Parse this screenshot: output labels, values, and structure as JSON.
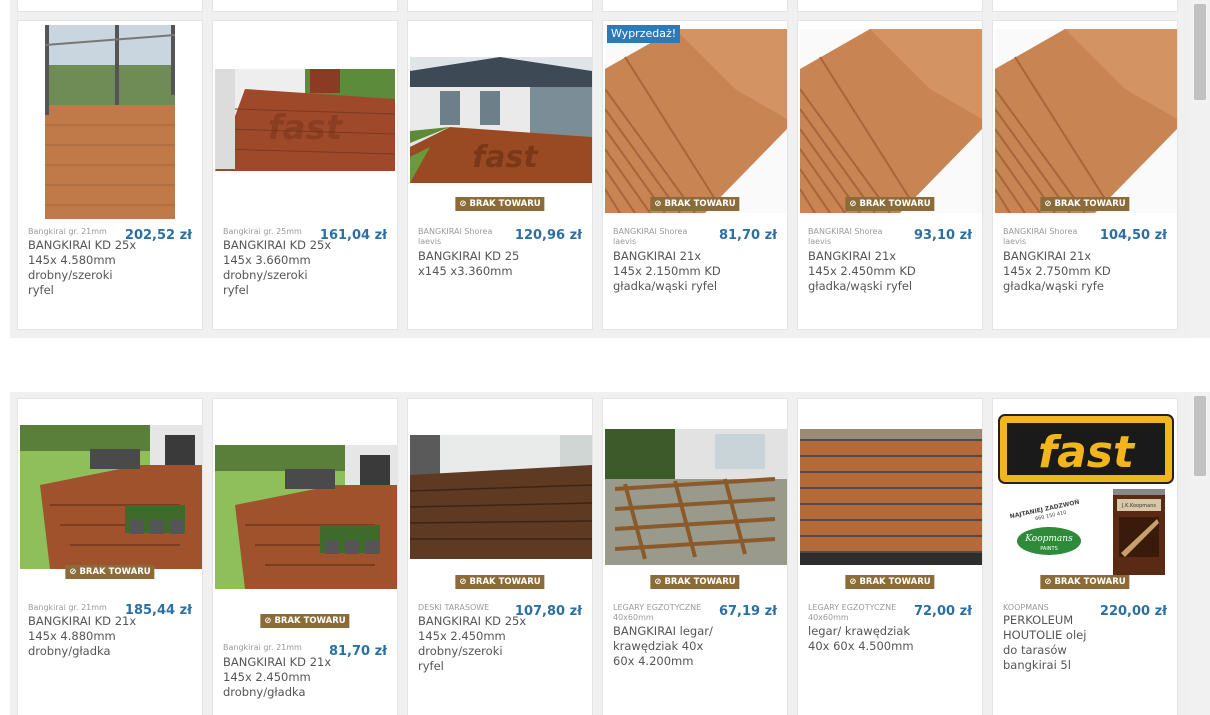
{
  "colors": {
    "price": "#2d6fa3",
    "out_of_stock_badge": "#8b6b38",
    "sale_badge": "#2c7ab8"
  },
  "out_of_stock_icon": "ban-icon",
  "row1": [
    {
      "category": "Bangkirai gr. 21mm",
      "title": "BANGKIRAI KD 25x 145x 4.580mm drobny/szeroki ryfel",
      "price": "202,52 zł",
      "badge": "",
      "out_of_stock": ""
    },
    {
      "category": "Bangkirai gr. 25mm",
      "title": "BANGKIRAI KD 25x 145x 3.660mm drobny/szeroki ryfel",
      "price": "161,04 zł",
      "badge": "",
      "out_of_stock": ""
    },
    {
      "category": "BANGKIRAI Shorea laevis",
      "title": "BANGKIRAI KD 25 x145 x3.360mm",
      "price": "120,96 zł",
      "badge": "",
      "out_of_stock": "BRAK TOWARU"
    },
    {
      "category": "BANGKIRAI Shorea laevis",
      "title": "BANGKIRAI 21x 145x 2.150mm KD gładka/wąski ryfel",
      "price": "81,70 zł",
      "badge": "Wyprzedaż!",
      "out_of_stock": "BRAK TOWARU"
    },
    {
      "category": "BANGKIRAI Shorea laevis",
      "title": "BANGKIRAI 21x 145x 2.450mm KD gładka/wąski ryfel",
      "price": "93,10 zł",
      "badge": "",
      "out_of_stock": "BRAK TOWARU"
    },
    {
      "category": "BANGKIRAI Shorea laevis",
      "title": "BANGKIRAI 21x 145x 2.750mm KD gładka/wąski ryfe",
      "price": "104,50 zł",
      "badge": "",
      "out_of_stock": "BRAK TOWARU"
    }
  ],
  "row2": [
    {
      "category": "Bangkirai gr. 21mm",
      "title": "BANGKIRAI KD 21x 145x 4.880mm drobny/gładka",
      "price": "185,44 zł",
      "out_of_stock": "BRAK TOWARU"
    },
    {
      "category": "Bangkirai gr. 21mm",
      "title": "BANGKIRAI KD 21x 145x 2.450mm drobny/gładka",
      "price": "81,70 zł",
      "out_of_stock": "BRAK TOWARU"
    },
    {
      "category": "DESKI TARASOWE",
      "title": "BANGKIRAI KD 25x 145x 2.450mm drobny/szeroki ryfel",
      "price": "107,80 zł",
      "out_of_stock": "BRAK TOWARU"
    },
    {
      "category": "LEGARY EGZOTYCZNE 40x60mm",
      "title": "BANGKIRAI legar/ krawędziak 40x 60x 4.200mm",
      "price": "67,19 zł",
      "out_of_stock": "BRAK TOWARU"
    },
    {
      "category": "LEGARY EGZOTYCZNE 40x60mm",
      "title": "legar/ krawędziak 40x 60x 4.500mm",
      "price": "72,00 zł",
      "out_of_stock": "BRAK TOWARU"
    },
    {
      "category": "KOOPMANS",
      "title": "PERKOLEUM HOUTOLIE olej do tarasów bangkirai 5l",
      "price": "220,00 zł",
      "out_of_stock": "BRAK TOWARU",
      "image_text": {
        "logo": "fast",
        "slogan": "NAJTANIEJ ZADZWOŃ",
        "phone": "660 150 410",
        "brand": "Koopmans",
        "brand_sub": "PAINTS",
        "can_label": "J.K.Koopmans"
      }
    }
  ]
}
